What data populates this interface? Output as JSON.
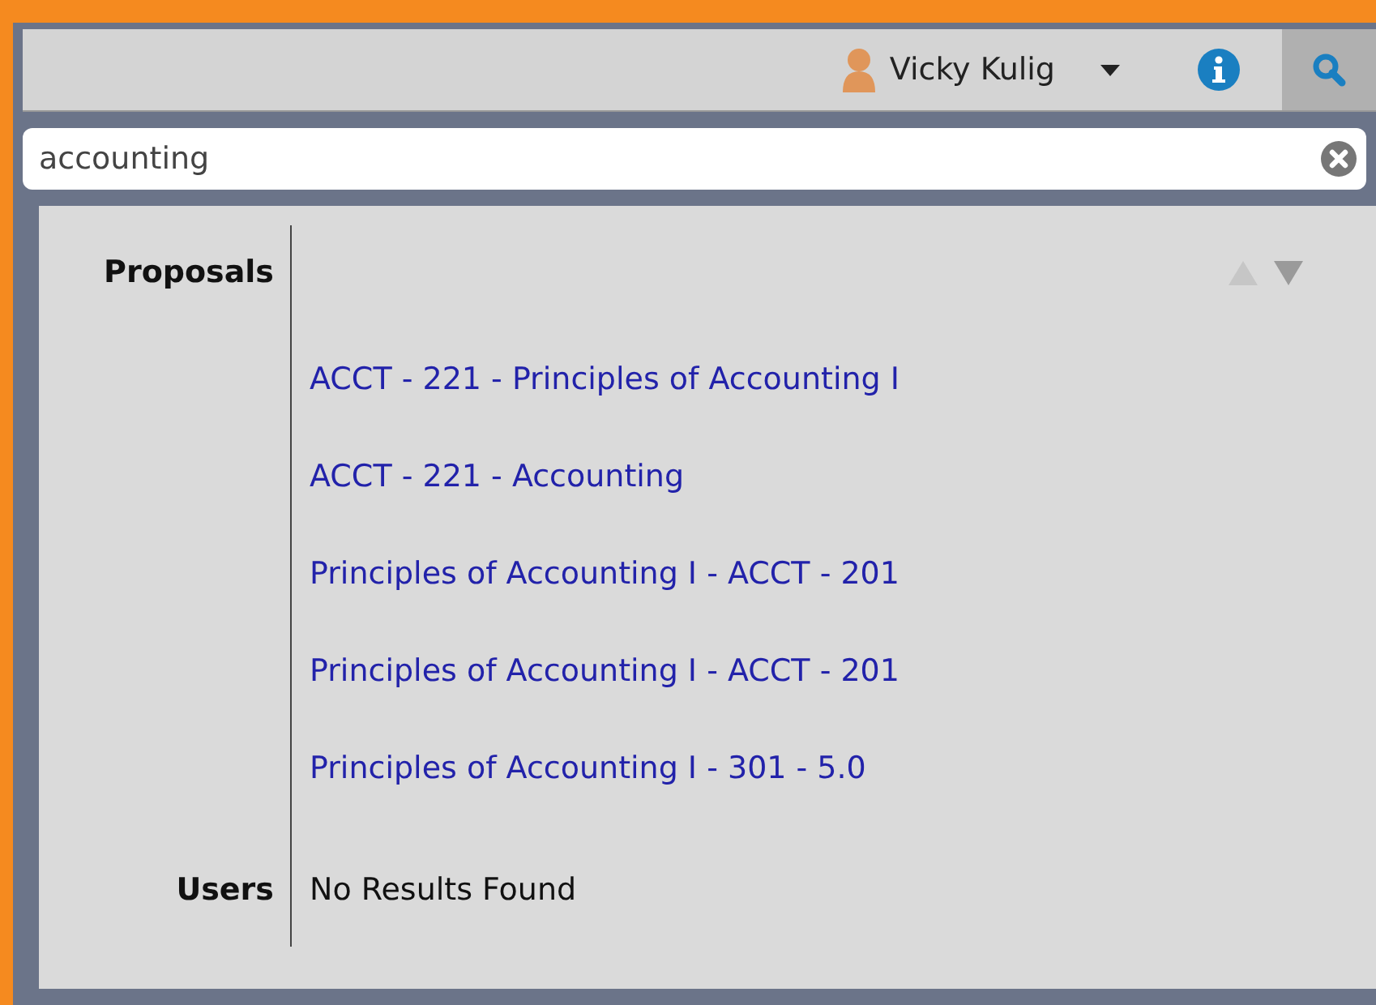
{
  "header": {
    "user_name": "Vicky Kulig"
  },
  "search": {
    "value": "accounting"
  },
  "sections": [
    {
      "label": "Proposals",
      "kind": "results",
      "arrows": [
        {
          "kind": "up",
          "disabled": true
        },
        {
          "kind": "down",
          "disabled": false
        }
      ],
      "results": [
        "ACCT - 221 - Principles of Accounting I",
        "ACCT - 221 - Accounting",
        "Principles of Accounting I - ACCT - 201",
        "Principles of Accounting I - ACCT - 201",
        "Principles of Accounting I - 301 - 5.0"
      ]
    },
    {
      "label": "Users",
      "kind": "empty",
      "message": "No Results Found"
    }
  ]
}
